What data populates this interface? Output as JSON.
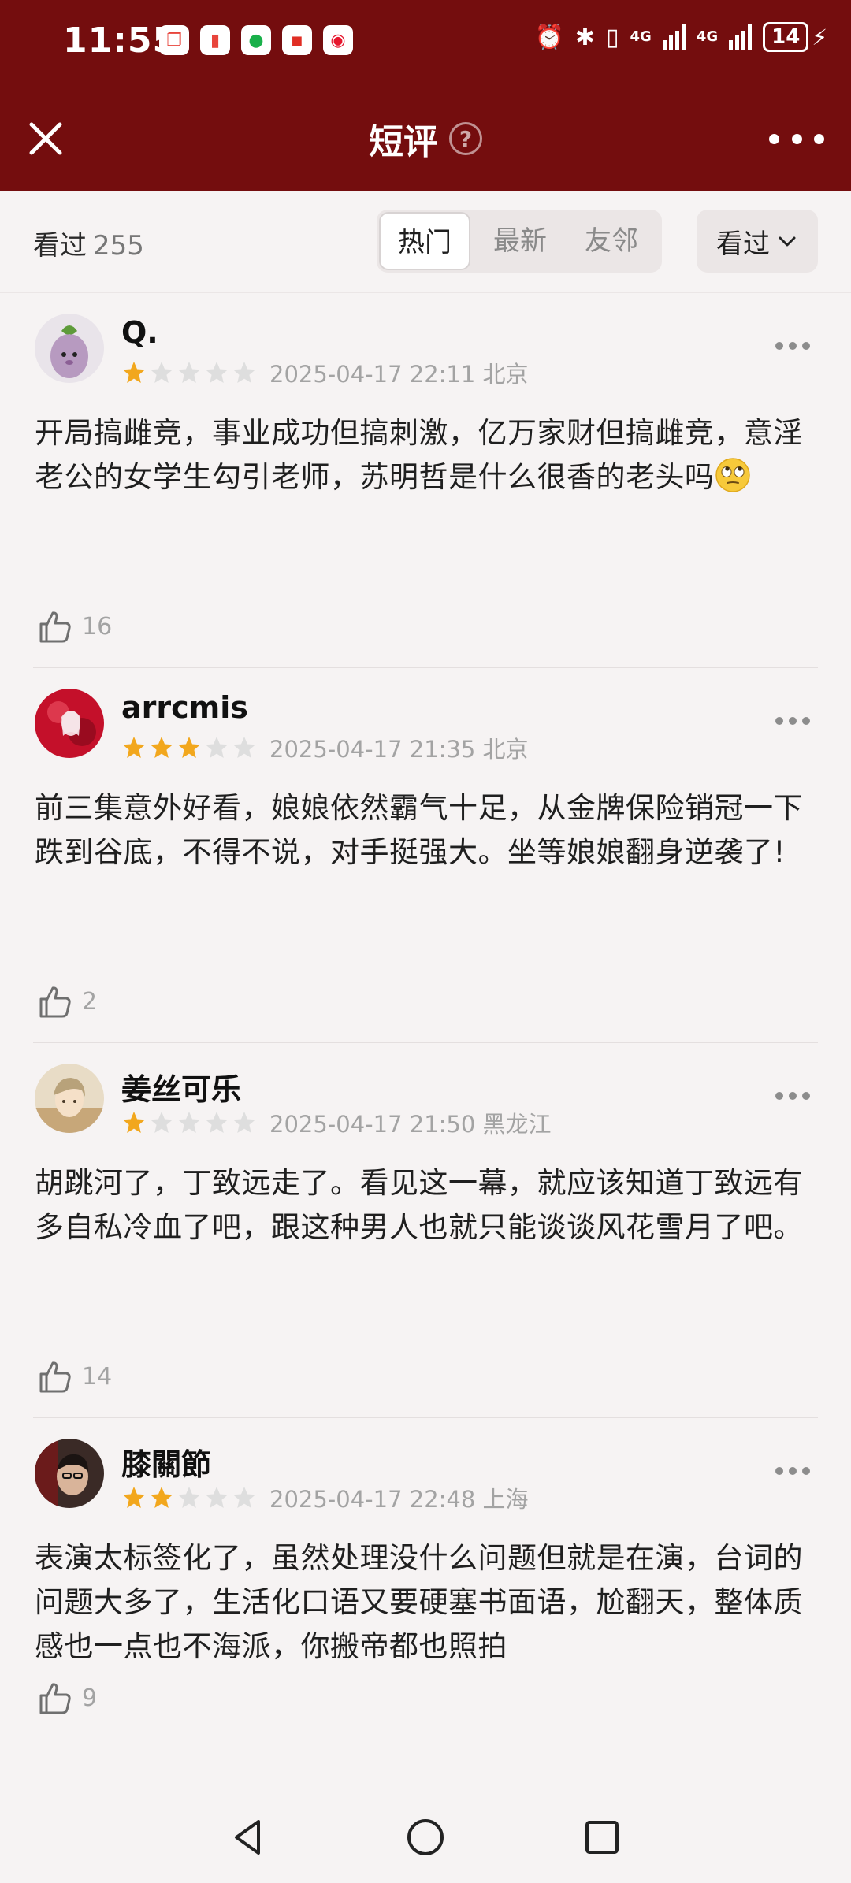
{
  "status_bar": {
    "time": "11:55",
    "network_1": "4G",
    "network_2": "4G",
    "battery": "14"
  },
  "header": {
    "title": "短评",
    "help_glyph": "?"
  },
  "filters": {
    "seen_label": "看过",
    "seen_count": "255",
    "tabs": [
      "热门",
      "最新",
      "友邻"
    ],
    "active_tab": "热门",
    "dropdown_label": "看过"
  },
  "reviews": [
    {
      "username": "Q.",
      "rating": 1,
      "datetime": "2025-04-17 22:11 北京",
      "content": "开局搞雌竞，事业成功但搞刺激，亿万家财但搞雌竞，意淫老公的女学生勾引老师，苏明哲是什么很香的老头吗",
      "emoji": "eye-roll-emoji",
      "likes": "16"
    },
    {
      "username": "arrcmis",
      "rating": 3,
      "datetime": "2025-04-17 21:35 北京",
      "content": "前三集意外好看，娘娘依然霸气十足，从金牌保险销冠一下跌到谷底，不得不说，对手挺强大。坐等娘娘翻身逆袭了!",
      "likes": "2"
    },
    {
      "username": "姜丝可乐",
      "rating": 1,
      "datetime": "2025-04-17 21:50 黑龙江",
      "content": "胡跳河了，丁致远走了。看见这一幕，就应该知道丁致远有多自私冷血了吧，跟这种男人也就只能谈谈风花雪月了吧。",
      "likes": "14"
    },
    {
      "username": "膝關節",
      "rating": 2,
      "datetime": "2025-04-17 22:48 上海",
      "content": "表演太标签化了，虽然处理没什么问题但就是在演，台词的问题大多了，生活化口语又要硬塞书面语，尬翻天，整体质感也一点也不海派，你搬帝都也照拍",
      "likes": "9"
    }
  ],
  "colors": {
    "header_bg": "#740d0e",
    "star_filled": "#f2a71d",
    "star_empty": "#dedede"
  }
}
